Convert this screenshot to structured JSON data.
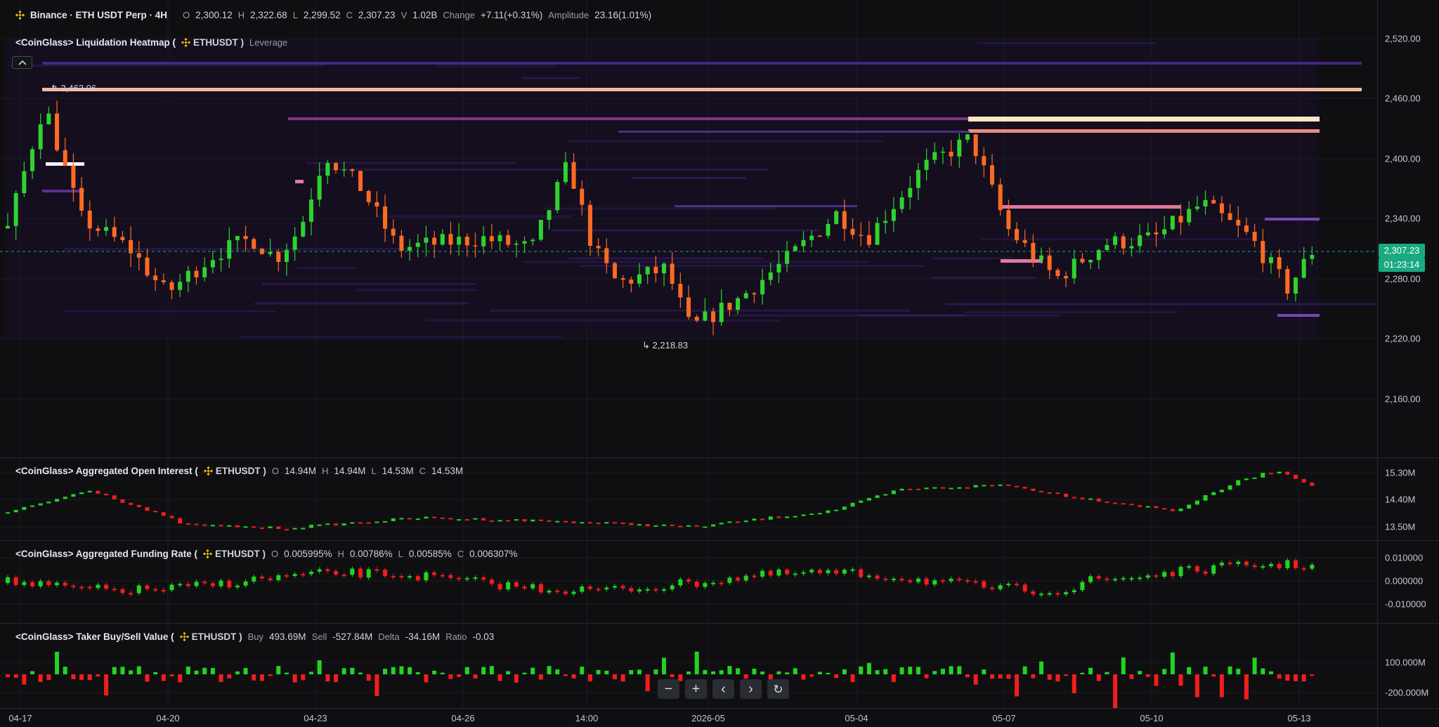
{
  "colors": {
    "up": "#2fd32f",
    "down": "#ff6a22",
    "up_sub": "#22d422",
    "down_sub": "#f21d1d",
    "price_label": "#1aa980",
    "background": "#0f0f12",
    "grid": "#1b1c22"
  },
  "main": {
    "symbol_title": "Binance · ETH USDT Perp · 4H",
    "ohlc": [
      {
        "k": "O",
        "v": "2,300.12"
      },
      {
        "k": "H",
        "v": "2,322.68"
      },
      {
        "k": "L",
        "v": "2,299.52"
      },
      {
        "k": "C",
        "v": "2,307.23"
      },
      {
        "k": "V",
        "v": "1.02B"
      }
    ],
    "change_label": "Change",
    "change_value": "+7.11(+0.31%)",
    "amplitude_label": "Amplitude",
    "amplitude_value": "23.16(1.01%)",
    "indicator_title": "<CoinGlass> Liquidation Heatmap (",
    "indicator_symbol": "ETHUSDT )",
    "indicator_param": "Leverage",
    "high_marker": "2,463.06",
    "low_marker": "2,218.83",
    "current_price": "2,307.23",
    "countdown": "01:23:14",
    "axis_ticks": [
      "2,520.00",
      "2,460.00",
      "2,400.00",
      "2,340.00",
      "2,280.00",
      "2,220.00",
      "2,160.00"
    ]
  },
  "open_interest": {
    "title": "<CoinGlass> Aggregated Open Interest (",
    "symbol": "ETHUSDT )",
    "ohlc": [
      {
        "k": "O",
        "v": "14.94M"
      },
      {
        "k": "H",
        "v": "14.94M"
      },
      {
        "k": "L",
        "v": "14.53M"
      },
      {
        "k": "C",
        "v": "14.53M"
      }
    ],
    "axis_ticks": [
      "15.30M",
      "14.40M",
      "13.50M"
    ]
  },
  "funding_rate": {
    "title": "<CoinGlass> Aggregated Funding Rate (",
    "symbol": "ETHUSDT )",
    "ohlc": [
      {
        "k": "O",
        "v": "0.005995%"
      },
      {
        "k": "H",
        "v": "0.00786%"
      },
      {
        "k": "L",
        "v": "0.00585%"
      },
      {
        "k": "C",
        "v": "0.006307%"
      }
    ],
    "axis_ticks": [
      "0.010000",
      "0.000000",
      "-0.010000"
    ]
  },
  "taker": {
    "title": "<CoinGlass> Taker Buy/Sell Value (",
    "symbol": "ETHUSDT )",
    "ohlc": [
      {
        "k": "Buy",
        "v": "493.69M"
      },
      {
        "k": "Sell",
        "v": "-527.84M"
      },
      {
        "k": "Delta",
        "v": "-34.16M"
      },
      {
        "k": "Ratio",
        "v": "-0.03"
      }
    ],
    "axis_ticks": [
      "100.000M",
      "-200.000M"
    ]
  },
  "time_axis": [
    "04-17",
    "04-20",
    "04-23",
    "04-26",
    "14:00",
    "2026-05",
    "05-04",
    "05-07",
    "05-10",
    "05-13"
  ],
  "nav": {
    "zoom_out": "−",
    "zoom_in": "+",
    "prev": "‹",
    "next": "›",
    "reset": "↻"
  }
}
